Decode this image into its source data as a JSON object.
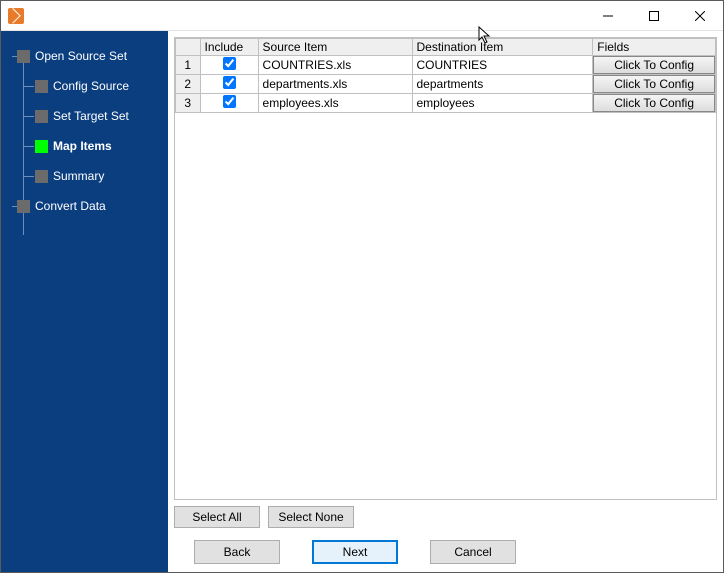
{
  "titlebar": {
    "title": ""
  },
  "sidebar": {
    "items": [
      {
        "label": "Open Source Set",
        "level": 0,
        "active": false
      },
      {
        "label": "Config Source",
        "level": 1,
        "active": false
      },
      {
        "label": "Set Target Set",
        "level": 1,
        "active": false
      },
      {
        "label": "Map Items",
        "level": 1,
        "active": true
      },
      {
        "label": "Summary",
        "level": 1,
        "active": false
      },
      {
        "label": "Convert Data",
        "level": 0,
        "active": false
      }
    ]
  },
  "table": {
    "headers": {
      "rownum": "",
      "include": "Include",
      "source": "Source Item",
      "dest": "Destination Item",
      "fields": "Fields"
    },
    "config_label": "Click To Config",
    "rows": [
      {
        "n": "1",
        "include": true,
        "source": "COUNTRIES.xls",
        "dest": "COUNTRIES"
      },
      {
        "n": "2",
        "include": true,
        "source": "departments.xls",
        "dest": "departments"
      },
      {
        "n": "3",
        "include": true,
        "source": "employees.xls",
        "dest": "employees"
      }
    ]
  },
  "buttons": {
    "select_all": "Select All",
    "select_none": "Select None",
    "back": "Back",
    "next": "Next",
    "cancel": "Cancel"
  }
}
